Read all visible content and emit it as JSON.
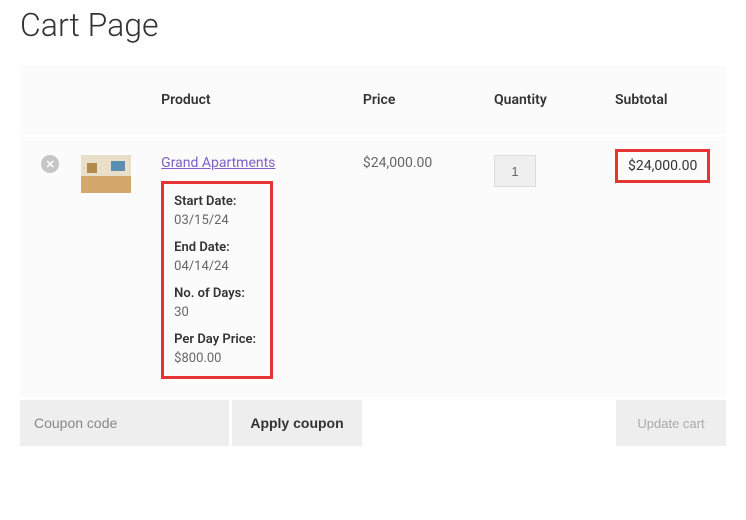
{
  "page_title": "Cart Page",
  "headers": {
    "product": "Product",
    "price": "Price",
    "quantity": "Quantity",
    "subtotal": "Subtotal"
  },
  "item": {
    "name": "Grand Apartments",
    "price": "$24,000.00",
    "quantity": "1",
    "subtotal": "$24,000.00",
    "meta": {
      "start_label": "Start Date:",
      "start_value": "03/15/24",
      "end_label": "End Date:",
      "end_value": "04/14/24",
      "days_label": "No. of Days:",
      "days_value": "30",
      "per_day_label": "Per Day Price:",
      "per_day_value": "$800.00"
    }
  },
  "coupon_placeholder": "Coupon code",
  "apply_label": "Apply coupon",
  "update_label": "Update cart"
}
